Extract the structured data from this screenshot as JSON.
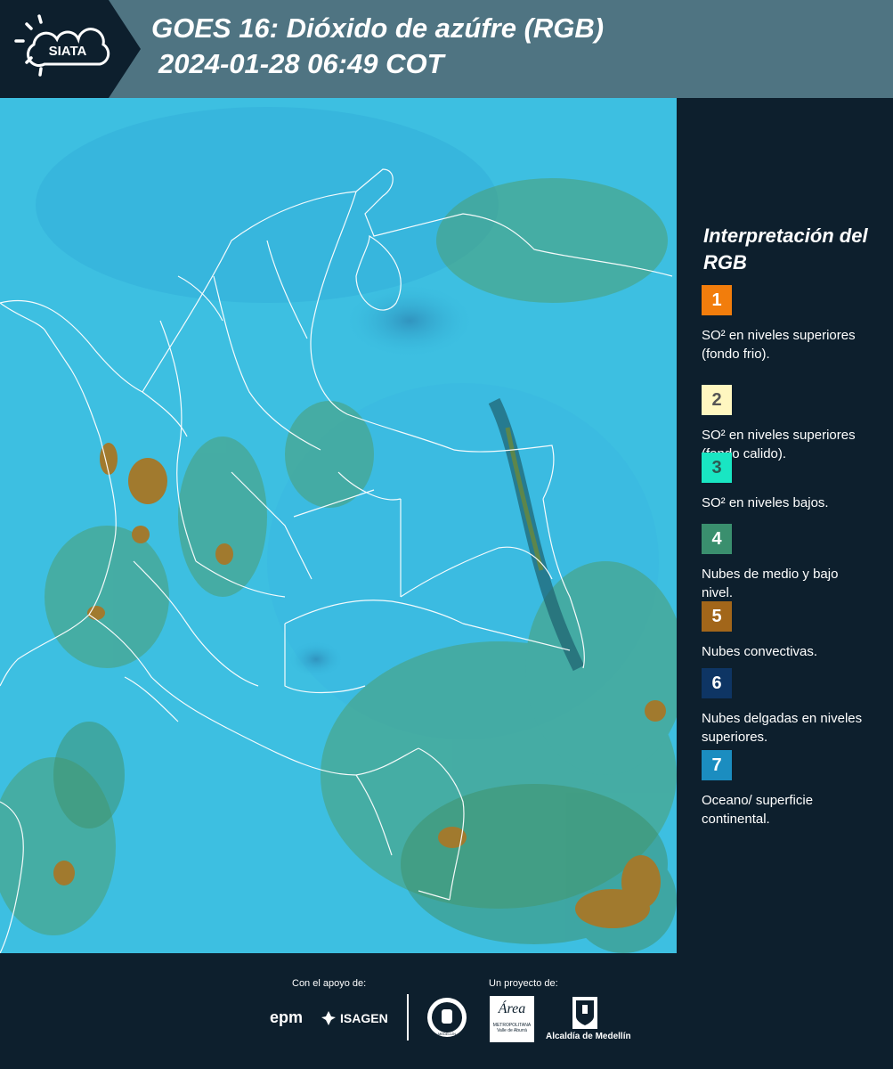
{
  "header": {
    "logo_text": "SIATA",
    "title_line1": "GOES 16: Dióxido de azúfre (RGB)",
    "title_line2": "2024-01-28 06:49 COT"
  },
  "map": {
    "product": "SO2 RGB satellite composite",
    "colors": {
      "base": "#33b9df",
      "land": "#3bb2c8",
      "green": "#4a9b72",
      "convective": "#a07a2c",
      "border": "#ffffff"
    }
  },
  "legend": {
    "title": "Interpretación del RGB",
    "items": [
      {
        "num": "1",
        "color": "#f27d0c",
        "num_color": "#ffffff",
        "text": "SO² en niveles superiores (fondo frio)."
      },
      {
        "num": "2",
        "color": "#fff7c0",
        "num_color": "#555555",
        "text": "SO² en niveles superiores (fondo calido)."
      },
      {
        "num": "3",
        "color": "#19e6c3",
        "num_color": "#2b5a52",
        "text": "SO² en niveles bajos."
      },
      {
        "num": "4",
        "color": "#3a8f6e",
        "num_color": "#ffffff",
        "text": "Nubes de medio y bajo nivel."
      },
      {
        "num": "5",
        "color": "#a2661a",
        "num_color": "#ffffff",
        "text": "Nubes convectivas."
      },
      {
        "num": "6",
        "color": "#0e3564",
        "num_color": "#ffffff",
        "text": "Nubes delgadas en niveles superiores."
      },
      {
        "num": "7",
        "color": "#1b8dc0",
        "num_color": "#ffffff",
        "text": "Oceano/ superficie continental."
      }
    ]
  },
  "footer": {
    "support_label": "Con el apoyo de:",
    "project_label": "Un proyecto de:",
    "epm": "epm",
    "isagen": "ISAGEN",
    "metro_a": "Área",
    "metro_sub": "METROPOLITANA",
    "metro_sub2": "Valle de Aburrá",
    "alcaldia": "Alcaldía de Medellín",
    "medellin_seal": "MEDELLÍN"
  }
}
